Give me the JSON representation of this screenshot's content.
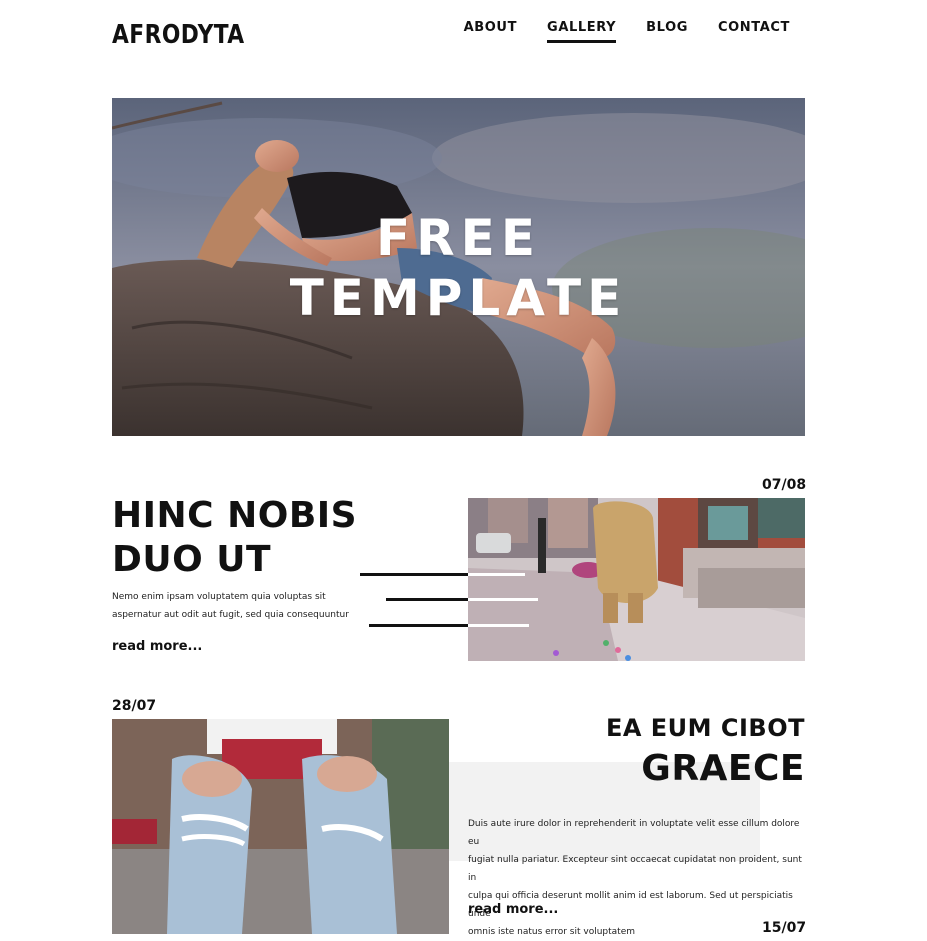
{
  "header": {
    "brand": "AFRODYTA",
    "nav": [
      {
        "label": "ABOUT",
        "active": false
      },
      {
        "label": "GALLERY",
        "active": true
      },
      {
        "label": "BLOG",
        "active": false
      },
      {
        "label": "CONTACT",
        "active": false
      }
    ]
  },
  "hero": {
    "title_line1": "FREE",
    "title_line2": "TEMPLATE"
  },
  "posts": [
    {
      "date": "07/08",
      "title_line1": "HINC NOBIS",
      "title_line2": "DUO UT",
      "body_line1": "Nemo enim ipsam voluptatem quia voluptas sit",
      "body_line2": "aspernatur aut odit aut fugit, sed quia consequuntur",
      "read_more": "read more..."
    },
    {
      "date": "28/07",
      "title_line1": "EA EUM CIBOT",
      "title_line2": "GRAECE",
      "body_line1": "Duis aute irure dolor in reprehenderit in voluptate velit esse cillum dolore eu",
      "body_line2": "fugiat nulla pariatur. Excepteur sint occaecat cupidatat non proident, sunt in",
      "body_line3": "culpa qui officia deserunt mollit anim id est laborum. Sed ut perspiciatis unde",
      "body_line4": "omnis iste natus error sit voluptatem",
      "read_more": "read more..."
    },
    {
      "date": "15/07"
    }
  ],
  "colors": {
    "text": "#111111",
    "background": "#ffffff",
    "panel": "#f2f2f2"
  }
}
